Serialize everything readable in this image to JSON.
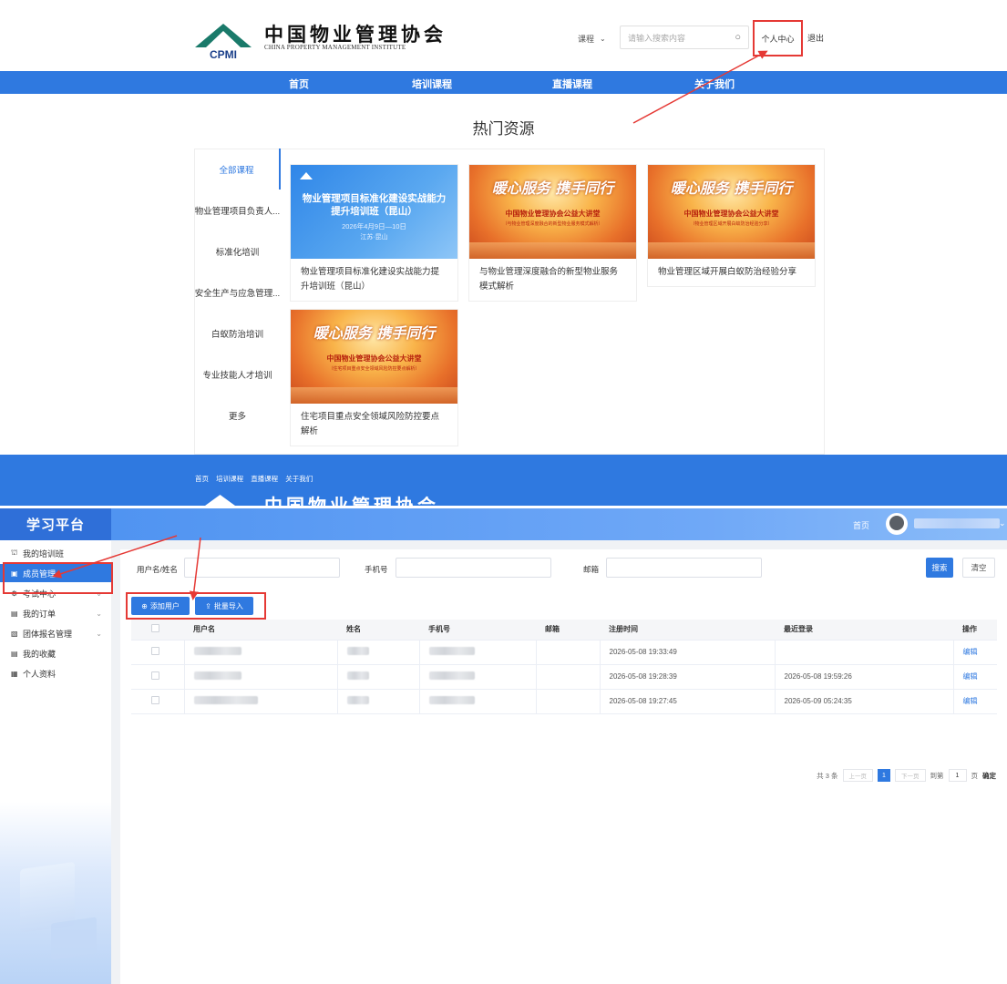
{
  "site": {
    "logo_cn": "中国物业管理协会",
    "logo_en": "CHINA PROPERTY MANAGEMENT INSTITUTE",
    "logo_abbr": "CPMI",
    "search_select": "课程",
    "search_placeholder": "请输入搜索内容",
    "user_center": "个人中心",
    "logout": "退出",
    "nav": [
      "首页",
      "培训课程",
      "直播课程",
      "关于我们"
    ],
    "hot_title": "热门资源",
    "categories": [
      "全部课程",
      "物业管理项目负责人...",
      "标准化培训",
      "安全生产与应急管理...",
      "白蚁防治培训",
      "专业技能人才培训",
      "更多"
    ],
    "cards": [
      {
        "title": "物业管理项目标准化建设实战能力提升培训班（昆山）",
        "thumb_line1": "物业管理项目标准化建设实战能力",
        "thumb_line2": "提升培训班（昆山）",
        "thumb_date": "2026年4月9日—10日",
        "thumb_place": "江苏·昆山"
      },
      {
        "title": "与物业管理深度融合的新型物业服务模式解析",
        "thumb_line1": "暖心服务 携手同行",
        "thumb_line2": "中国物业管理协会公益大讲堂",
        "thumb_line3": "（与物业管理深度融合的新型物业服务模式解析）"
      },
      {
        "title": "物业管理区域开展白蚁防治经验分享",
        "thumb_line1": "暖心服务 携手同行",
        "thumb_line2": "中国物业管理协会公益大讲堂",
        "thumb_line3": "（物业管理区域开展白蚁防治经验分享）"
      },
      {
        "title": "住宅项目重点安全领域风险防控要点解析",
        "thumb_line1": "暖心服务 携手同行",
        "thumb_line2": "中国物业管理协会公益大讲堂",
        "thumb_line3": "（住宅项目重点安全领域风险防控要点解析）"
      }
    ],
    "footer_links": [
      "首页",
      "培训课程",
      "直播课程",
      "关于我们"
    ],
    "footer_cn": "中国物业管理协会"
  },
  "platform": {
    "brand": "学习平台",
    "home": "首页",
    "sidebar": [
      {
        "label": "我的培训班",
        "icon": "graduation-icon",
        "glyph": "⛫",
        "expandable": false
      },
      {
        "label": "成员管理",
        "icon": "member-icon",
        "glyph": "▣",
        "expandable": false,
        "active": true
      },
      {
        "label": "考试中心",
        "icon": "exam-icon",
        "glyph": "⚙",
        "expandable": true
      },
      {
        "label": "我的订单",
        "icon": "order-icon",
        "glyph": "▤",
        "expandable": true
      },
      {
        "label": "团体报名管理",
        "icon": "group-icon",
        "glyph": "▧",
        "expandable": true
      },
      {
        "label": "我的收藏",
        "icon": "favorite-icon",
        "glyph": "▤",
        "expandable": false
      },
      {
        "label": "个人资料",
        "icon": "profile-icon",
        "glyph": "▦",
        "expandable": false
      }
    ],
    "filters": {
      "username_label": "用户名/姓名",
      "phone_label": "手机号",
      "email_label": "邮箱",
      "search": "搜索",
      "clear": "清空"
    },
    "actions": {
      "add_user": "添加用户",
      "batch_import": "批量导入"
    },
    "table": {
      "headers": [
        "用户名",
        "姓名",
        "手机号",
        "邮箱",
        "注册时间",
        "最近登录",
        "操作"
      ],
      "rows": [
        {
          "register_time": "2026-05-08 19:33:49",
          "last_login": "",
          "action": "编辑"
        },
        {
          "register_time": "2026-05-08 19:28:39",
          "last_login": "2026-05-08 19:59:26",
          "action": "编辑"
        },
        {
          "register_time": "2026-05-08 19:27:45",
          "last_login": "2026-05-09 05:24:35",
          "action": "编辑"
        }
      ]
    },
    "pager": {
      "total": "共 3 条",
      "prev": "上一页",
      "page": "1",
      "next": "下一页",
      "goto": "到第",
      "page_input": "1",
      "page_unit": "页",
      "confirm": "确定"
    }
  },
  "colors": {
    "brand_blue": "#2f79e0",
    "annotation_red": "#e53935"
  }
}
